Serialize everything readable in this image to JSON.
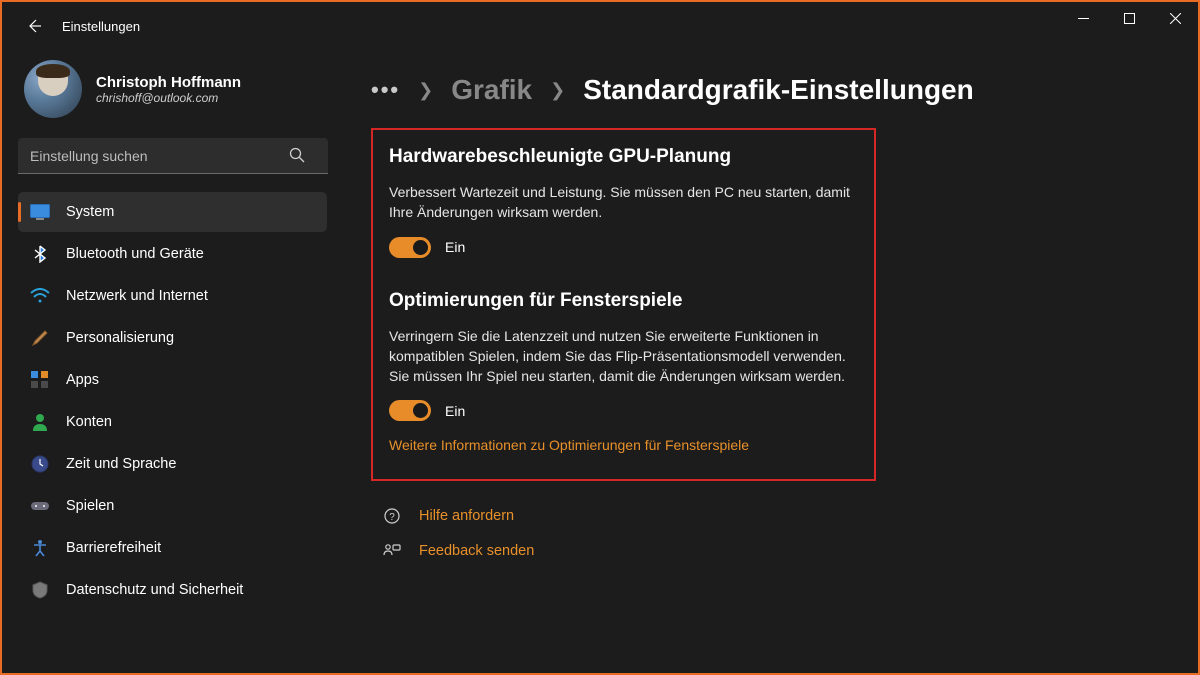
{
  "window": {
    "title": "Einstellungen"
  },
  "user": {
    "name": "Christoph Hoffmann",
    "email": "chrishoff@outlook.com"
  },
  "search": {
    "placeholder": "Einstellung suchen"
  },
  "sidebar": {
    "items": [
      {
        "label": "System",
        "icon": "system",
        "active": true
      },
      {
        "label": "Bluetooth und Geräte",
        "icon": "bluetooth"
      },
      {
        "label": "Netzwerk und Internet",
        "icon": "wifi"
      },
      {
        "label": "Personalisierung",
        "icon": "brush"
      },
      {
        "label": "Apps",
        "icon": "apps"
      },
      {
        "label": "Konten",
        "icon": "account"
      },
      {
        "label": "Zeit und Sprache",
        "icon": "clock"
      },
      {
        "label": "Spielen",
        "icon": "gamepad"
      },
      {
        "label": "Barrierefreiheit",
        "icon": "accessibility"
      },
      {
        "label": "Datenschutz und Sicherheit",
        "icon": "shield"
      }
    ]
  },
  "breadcrumb": {
    "parent": "Grafik",
    "current": "Standardgrafik-Einstellungen"
  },
  "sections": {
    "gpu": {
      "title": "Hardwarebeschleunigte GPU-Planung",
      "desc": "Verbessert Wartezeit und Leistung. Sie müssen den PC neu starten, damit Ihre Änderungen wirksam werden.",
      "toggle_label": "Ein",
      "toggle_on": true
    },
    "windowed": {
      "title": "Optimierungen für Fensterspiele",
      "desc": "Verringern Sie die Latenzzeit und nutzen Sie erweiterte Funktionen in kompatiblen Spielen, indem Sie das Flip-Präsentationsmodell verwenden. Sie müssen Ihr Spiel neu starten, damit die Änderungen wirksam werden.",
      "toggle_label": "Ein",
      "toggle_on": true,
      "more_link": "Weitere Informationen zu Optimierungen für Fensterspiele"
    }
  },
  "footer": {
    "help": "Hilfe anfordern",
    "feedback": "Feedback senden"
  },
  "colors": {
    "accent": "#e86c24",
    "link": "#e8902a"
  }
}
